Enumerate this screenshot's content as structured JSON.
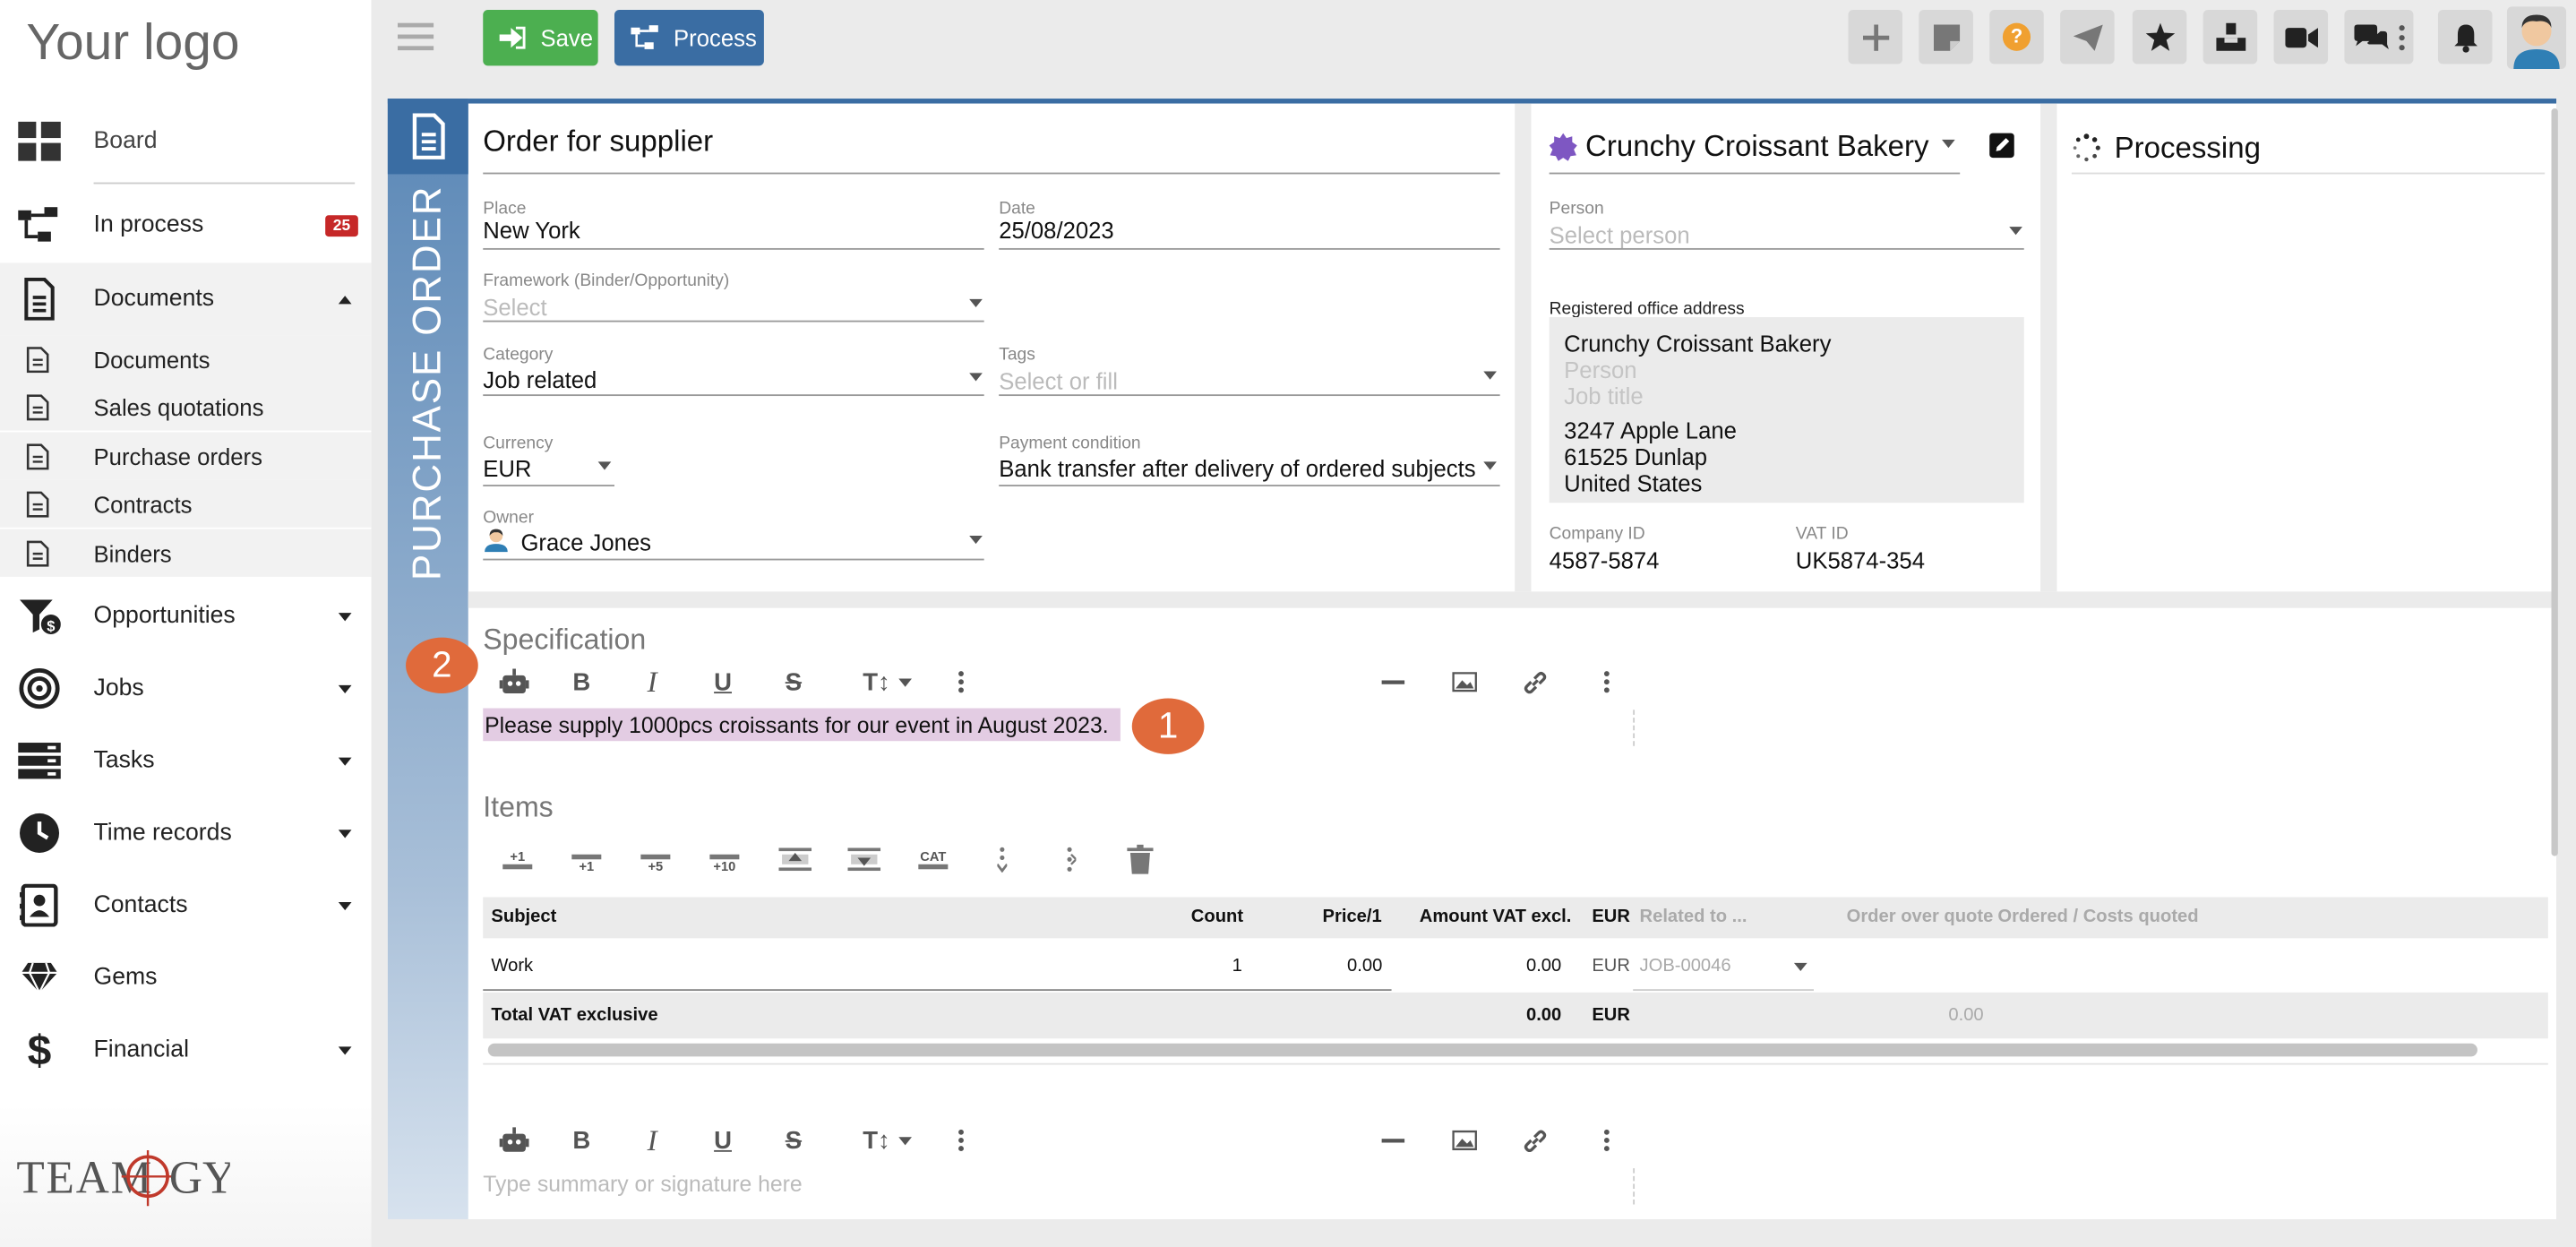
{
  "app": {
    "logo_text": "Your logo",
    "brand_footer": "TEAMOGY"
  },
  "sidebar": {
    "items": [
      {
        "label": "Board"
      },
      {
        "label": "In process",
        "badge": "25"
      },
      {
        "label": "Documents"
      },
      {
        "label": "Opportunities"
      },
      {
        "label": "Jobs"
      },
      {
        "label": "Tasks"
      },
      {
        "label": "Time records"
      },
      {
        "label": "Contacts"
      },
      {
        "label": "Gems"
      },
      {
        "label": "Financial"
      }
    ],
    "documents_sub": [
      {
        "label": "Documents"
      },
      {
        "label": "Sales quotations"
      },
      {
        "label": "Purchase orders"
      },
      {
        "label": "Contracts"
      },
      {
        "label": "Binders"
      }
    ]
  },
  "toolbar": {
    "save_label": "Save",
    "process_label": "Process",
    "help_glyph": "?"
  },
  "document": {
    "type_label": "PURCHASE ORDER",
    "title": "Order for supplier",
    "place": {
      "label": "Place",
      "value": "New York"
    },
    "date": {
      "label": "Date",
      "value": "25/08/2023"
    },
    "framework": {
      "label": "Framework (Binder/Opportunity)",
      "placeholder": "Select"
    },
    "category": {
      "label": "Category",
      "value": "Job related"
    },
    "tags": {
      "label": "Tags",
      "placeholder": "Select or fill"
    },
    "currency": {
      "label": "Currency",
      "value": "EUR"
    },
    "payment": {
      "label": "Payment condition",
      "value": "Bank transfer after delivery of ordered subjects"
    },
    "owner": {
      "label": "Owner",
      "value": "Grace Jones"
    }
  },
  "supplier": {
    "name": "Crunchy Croissant Bakery",
    "person_label": "Person",
    "person_placeholder": "Select person",
    "address_label": "Registered office address",
    "address_name": "Crunchy Croissant Bakery",
    "address_person": "Person",
    "address_jobtitle": "Job title",
    "street": "3247 Apple Lane",
    "city": "61525 Dunlap",
    "country": "United States",
    "company_id_label": "Company ID",
    "company_id": "4587-5874",
    "vat_id_label": "VAT ID",
    "vat_id": "UK5874-354"
  },
  "processing": {
    "title": "Processing"
  },
  "specification": {
    "title": "Specification",
    "text": "Please supply 1000pcs croissants for our event in August 2023."
  },
  "items": {
    "title": "Items",
    "toolbar": {
      "plus1": "+1",
      "plus1b": "+1",
      "plus5": "+5",
      "plus10": "+10",
      "cat": "CAT"
    },
    "headers": {
      "subject": "Subject",
      "count": "Count",
      "price": "Price/1",
      "amount": "Amount VAT excl.",
      "currency": "EUR",
      "related": "Related to ...",
      "order_over_quote": "Order over quote",
      "ordered_costs": "Ordered / Costs quoted"
    },
    "rows": [
      {
        "subject": "Work",
        "count": "1",
        "price": "0.00",
        "amount": "0.00",
        "currency": "EUR",
        "related": "JOB-00046"
      }
    ],
    "total": {
      "label": "Total VAT exclusive",
      "amount": "0.00",
      "currency": "EUR",
      "ordered": "0.00"
    }
  },
  "summary": {
    "placeholder": "Type summary or signature here"
  },
  "annotations": {
    "step1": "1",
    "step2": "2"
  }
}
